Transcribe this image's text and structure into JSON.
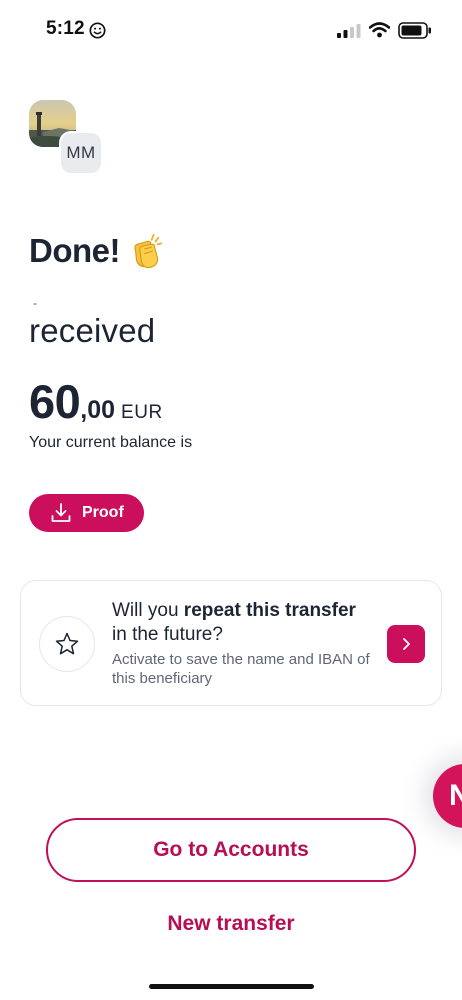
{
  "status_bar": {
    "time": "5:12",
    "icons": [
      "smiley-icon",
      "cellular-signal-icon",
      "wifi-icon",
      "battery-icon"
    ]
  },
  "recipient": {
    "initials": "MM",
    "photo_icon": "landscape-photo-avatar"
  },
  "confirmation": {
    "title": "Done!",
    "emoji": "clapping-hands-emoji",
    "dash": "-",
    "status": "received",
    "amount_integer": "60",
    "amount_decimal": ",00",
    "currency": "EUR",
    "balance_label": "Your current balance is"
  },
  "proof_button": {
    "label": "Proof",
    "icon": "download-icon"
  },
  "repeat_card": {
    "title_part1": "Will you ",
    "title_bold1": "repeat this transfer",
    "title_part2": " in the future?",
    "subtitle": "Activate to save the name and IBAN of this beneficiary",
    "icon": "star-icon",
    "action_icon": "chevron-right-icon"
  },
  "fab": {
    "label": "N"
  },
  "actions": {
    "primary": "Go to Accounts",
    "secondary": "New transfer"
  },
  "colors": {
    "brand": "#cc0f5d",
    "text": "#1d2433",
    "muted": "#5f6675"
  }
}
